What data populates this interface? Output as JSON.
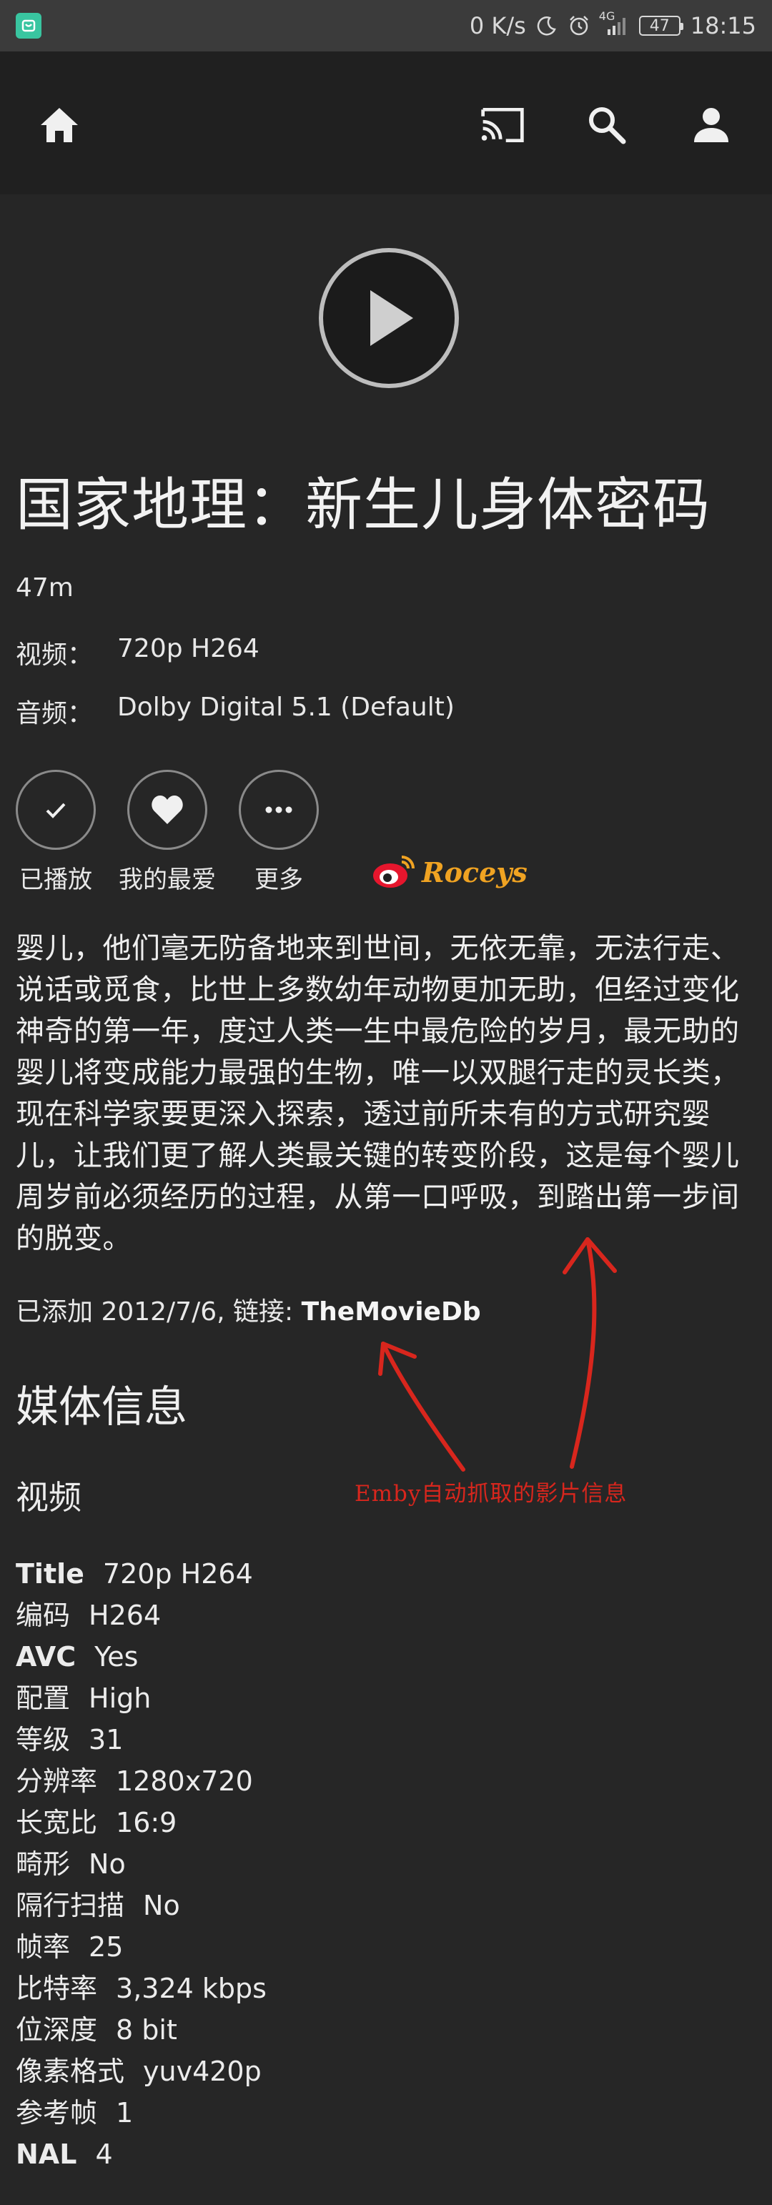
{
  "status_bar": {
    "net_speed": "0 K/s",
    "network_type": "4G",
    "battery": "47",
    "time": "18:15",
    "icons": [
      "app-notification-icon",
      "moon-icon",
      "alarm-icon",
      "signal-icon",
      "battery-icon"
    ]
  },
  "toolbar": {
    "icons": [
      "home-icon",
      "cast-icon",
      "search-icon",
      "user-icon"
    ]
  },
  "media": {
    "title": "国家地理：新生儿身体密码",
    "runtime": "47m",
    "video_label": "视频：",
    "video_value": "720p H264",
    "audio_label": "音频：",
    "audio_value": "Dolby Digital 5.1 (Default)"
  },
  "actions": [
    {
      "label": "已播放",
      "icon": "check-icon"
    },
    {
      "label": "我的最爱",
      "icon": "heart-icon"
    },
    {
      "label": "更多",
      "icon": "more-icon"
    }
  ],
  "watermark": {
    "text": "Roceys",
    "icon": "weibo-icon"
  },
  "overview": "婴儿，他们毫无防备地来到世间，无依无靠，无法行走、说话或觅食，比世上多数幼年动物更加无助，但经过变化神奇的第一年，度过人类一生中最危险的岁月，最无助的婴儿将变成能力最强的生物，唯一以双腿行走的灵长类，现在科学家要更深入探索，透过前所未有的方式研究婴儿，让我们更了解人类最关键的转变阶段，这是每个婴儿周岁前必须经历的过程，从第一口呼吸，到踏出第一步间的脱变。",
  "added": {
    "prefix": "已添加 2012/7/6, 链接: ",
    "link": "TheMovieDb"
  },
  "section_title": "媒体信息",
  "stream_title": "视频",
  "stream_info": [
    {
      "key": "Title",
      "value": "720p H264",
      "bold": true
    },
    {
      "key": "编码",
      "value": "H264",
      "bold": false
    },
    {
      "key": "AVC",
      "value": "Yes",
      "bold": true
    },
    {
      "key": "配置",
      "value": "High",
      "bold": false
    },
    {
      "key": "等级",
      "value": "31",
      "bold": false
    },
    {
      "key": "分辨率",
      "value": "1280x720",
      "bold": false
    },
    {
      "key": "长宽比",
      "value": "16:9",
      "bold": false
    },
    {
      "key": "畸形",
      "value": "No",
      "bold": false
    },
    {
      "key": "隔行扫描",
      "value": "No",
      "bold": false
    },
    {
      "key": "帧率",
      "value": "25",
      "bold": false
    },
    {
      "key": "比特率",
      "value": "3,324 kbps",
      "bold": false
    },
    {
      "key": "位深度",
      "value": "8 bit",
      "bold": false
    },
    {
      "key": "像素格式",
      "value": "yuv420p",
      "bold": false
    },
    {
      "key": "参考帧",
      "value": "1",
      "bold": false
    },
    {
      "key": "NAL",
      "value": "4",
      "bold": true
    }
  ],
  "annotation": "Emby自动抓取的影片信息",
  "colors": {
    "background": "#262626",
    "annotation": "#d8261d",
    "watermark": "#f0a322"
  }
}
